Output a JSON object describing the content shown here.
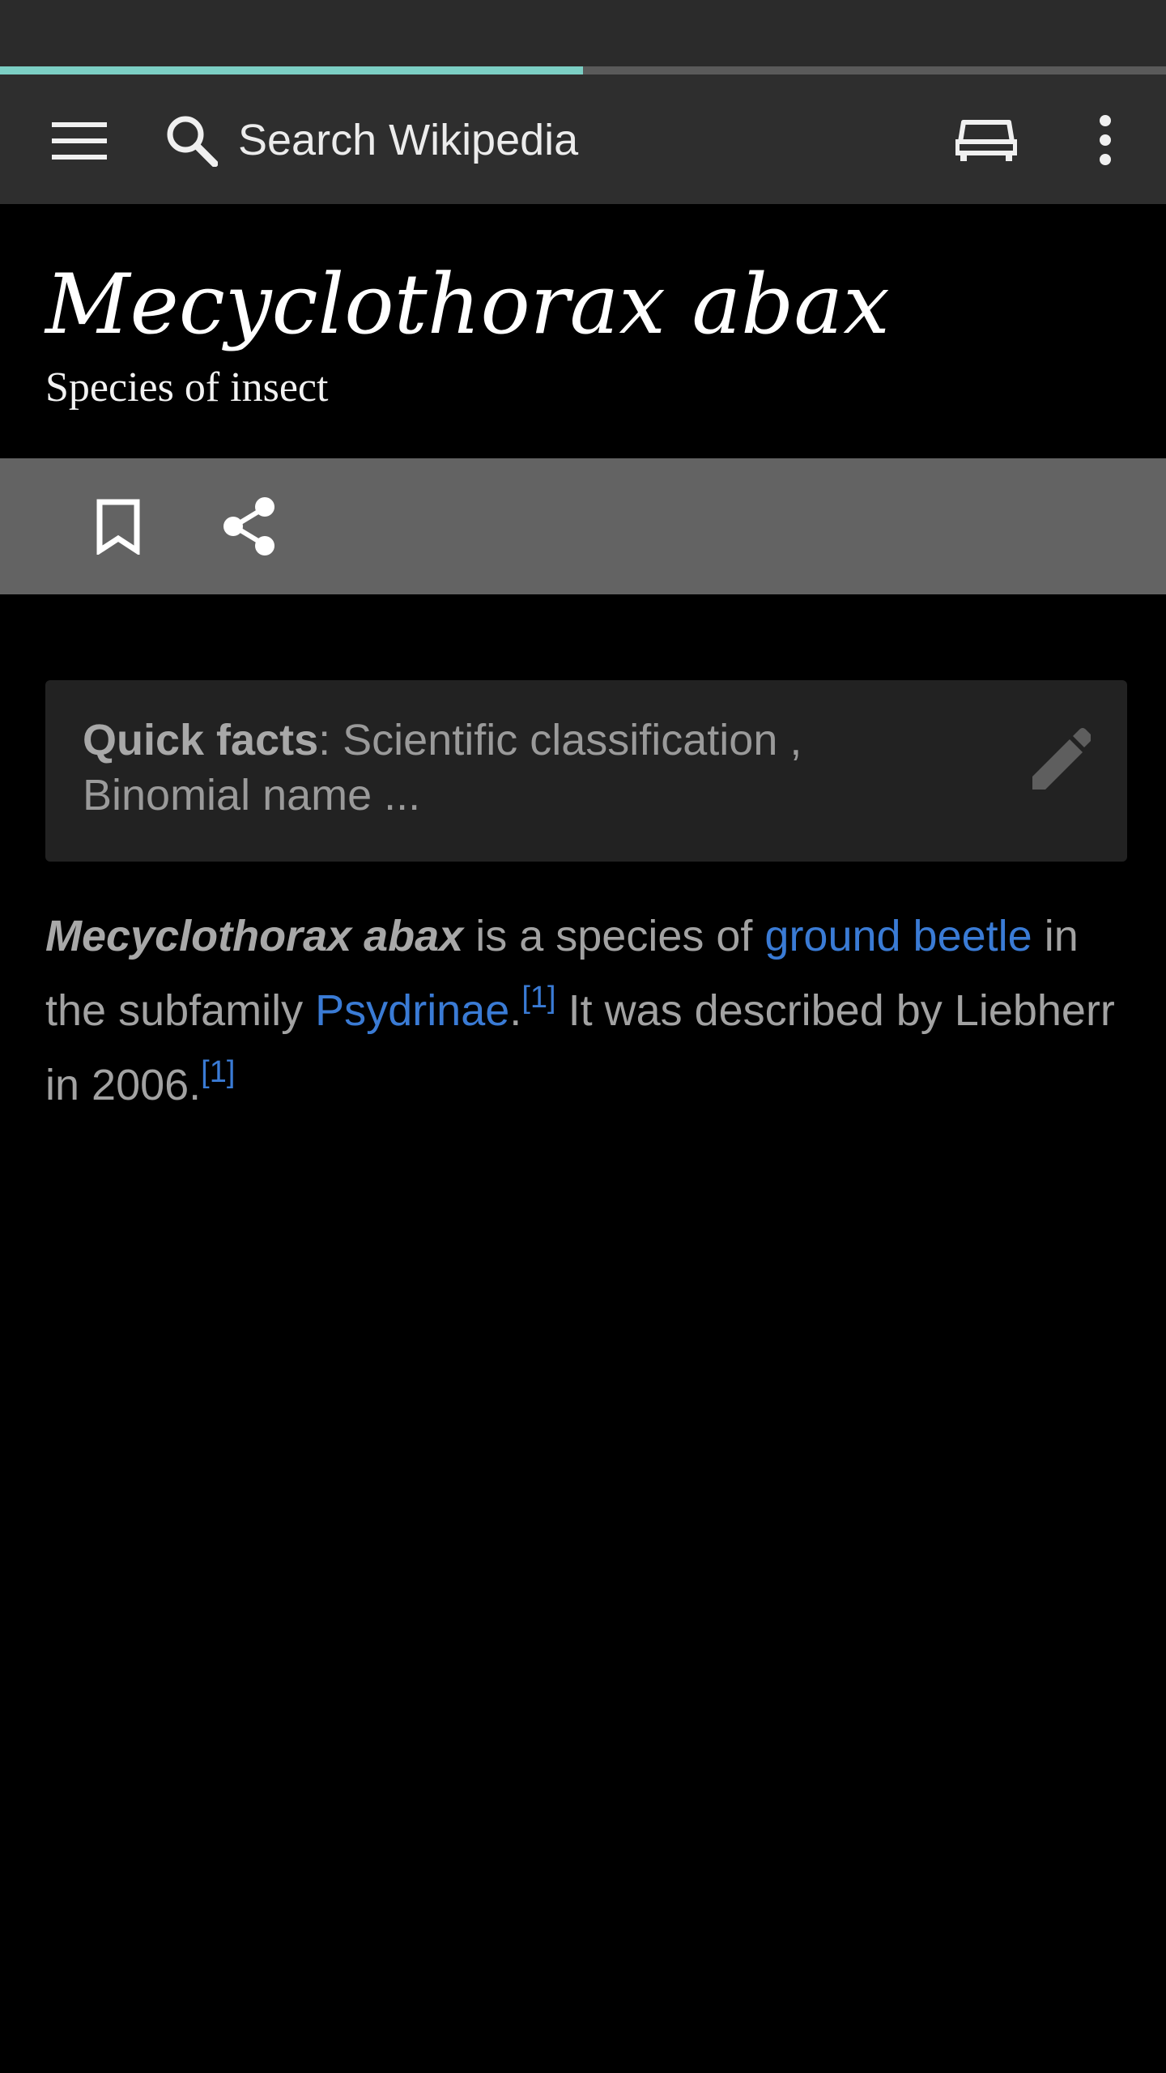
{
  "toolbar": {
    "search_placeholder": "Search Wikipedia",
    "load_progress_percent": 50
  },
  "header": {
    "title": "Mecyclothorax abax",
    "subtitle": "Species of insect"
  },
  "quick_facts": {
    "label": "Quick facts",
    "separator": ": ",
    "line1": "Scientific classification ,",
    "line2": "Binomial name ..."
  },
  "article": {
    "s1_bold": "Mecyclothorax abax",
    "s1_text": " is a species of ",
    "link_ground_beetle": "ground beetle",
    "s1_text2": " in the subfamily ",
    "link_psydrinae": "Psydrinae",
    "s1_end": ".",
    "ref1": "[1]",
    "s2_text": " It was described by Liebherr in 2006.",
    "ref2": "[1]"
  },
  "icons": {
    "menu": "menu-icon",
    "search": "search-icon",
    "tabs": "tabs-icon",
    "overflow": "overflow-menu-icon",
    "bookmark": "bookmark-icon",
    "share": "share-icon",
    "edit": "edit-pencil-icon"
  },
  "colors": {
    "accent_progress": "#7ccfc4",
    "link": "#3a7bd5"
  }
}
